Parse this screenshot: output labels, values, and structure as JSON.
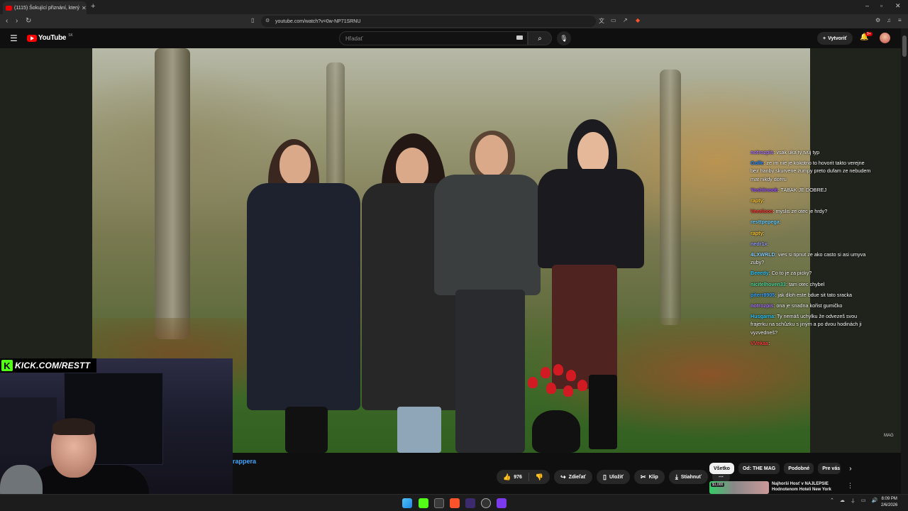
{
  "browser": {
    "tab_title": "(1115) Šokující přiznání, který",
    "new_tab": "+",
    "url": "youtube.com/watch?v=0w-NP71SRNU"
  },
  "youtube": {
    "logo_text": "YouTube",
    "region": "SK",
    "search_placeholder": "Hľadať",
    "create_label": "Vytvoriť",
    "notif_count": "9+"
  },
  "video": {
    "watermark": "MAG"
  },
  "overlay": {
    "kick_url": "KICK.COM/RESTT"
  },
  "chat": [
    {
      "user": "notrozpis",
      "sep": ": ",
      "msg": "vsak uka ty tvuj typ",
      "color": "#b07cff"
    },
    {
      "user": "Golfe",
      "sep": ": ",
      "msg": "ze im nie je kokotno to hovorit takto verejne bez hanby skurvene žumpy preto dufam ze nebudem mat nikdy dcéru",
      "color": "#2e8bff"
    },
    {
      "user": "YoshiInoob",
      "sep": ": ",
      "msg": "TABAK JE DOBREJ",
      "color": "#9b59ff"
    },
    {
      "user": "rapty",
      "sep": ": ",
      "msg": "",
      "color": "#ffcc33"
    },
    {
      "user": "Veeelooo",
      "sep": ": ",
      "msg": "myslis ze otec je hrdy?",
      "color": "#ff3b3b"
    },
    {
      "user": "resttpepega",
      "sep": ": ",
      "msg": "",
      "color": "#6fd3ff"
    },
    {
      "user": "rapty",
      "sep": ": ",
      "msg": "",
      "color": "#ffcc33"
    },
    {
      "user": "nedr1x",
      "sep": ": ",
      "msg": "",
      "color": "#9aa0ff"
    },
    {
      "user": "4LXWRLD",
      "sep": ": ",
      "msg": "vies si tipnut ze ako casto si asi umyva zuby?",
      "color": "#8fd3ff"
    },
    {
      "user": "Beeedy",
      "sep": ": ",
      "msg": "Co to je za picky?",
      "color": "#33ccff"
    },
    {
      "user": "nicitelhoven33",
      "sep": ": ",
      "msg": "tam otec chybel",
      "color": "#55e0a0"
    },
    {
      "user": "piterr8905",
      "sep": ": ",
      "msg": "jak dloh este bdue sit tato sracka",
      "color": "#3da8ff"
    },
    {
      "user": "notrozpis",
      "sep": ": ",
      "msg": "ona je snadna kořist gumičko",
      "color": "#b07cff"
    },
    {
      "user": "Husgarna",
      "sep": ": ",
      "msg": "Ty nemáš uchylku že odvezeš svou frajerku na schůzku s jiným a po dvou hodinách ji vyzvedneš?",
      "color": "#33ccff"
    },
    {
      "user": "VVekaa",
      "sep": ": ",
      "msg": "",
      "color": "#ff4444"
    }
  ],
  "below_video": {
    "channel_link": "rappera",
    "like_count": "976",
    "share_label": "Zdieľať",
    "save_label": "Uložiť",
    "clip_label": "Klip",
    "download_label": "Stiahnuť",
    "more_label": "⋯"
  },
  "chips": [
    "Všetko",
    "Od: THE MAG",
    "Podobné",
    "Pre vás"
  ],
  "recommendation": {
    "price_badge": "$1,000",
    "title": "Najhorší Hosť v NAJLEPŠIE Hodnotenom Hoteli New York"
  },
  "taskbar": {
    "time": "8:09 PM",
    "date": "2/6/2026"
  }
}
